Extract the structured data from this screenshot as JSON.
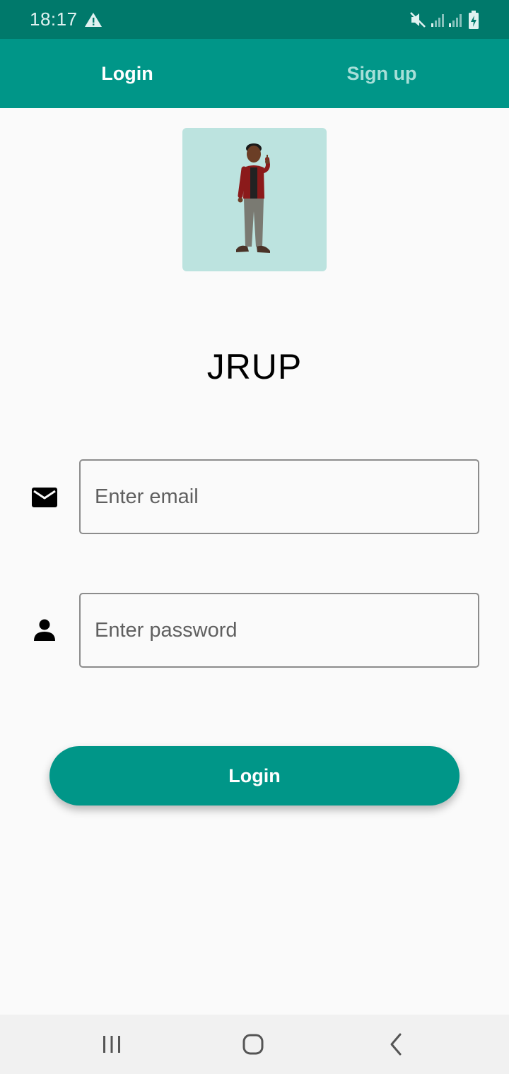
{
  "status_bar": {
    "time": "18:17",
    "icons": [
      "warning-icon",
      "mute-icon",
      "signal-icon",
      "signal-icon",
      "battery-charging-icon"
    ]
  },
  "tabs": [
    {
      "label": "Login",
      "active": true
    },
    {
      "label": "Sign up",
      "active": false
    }
  ],
  "avatar": {
    "description_icon": "avatar-image"
  },
  "app": {
    "title": "JRUP"
  },
  "form": {
    "email_placeholder": "Enter email",
    "email_icon": "mail-icon",
    "password_placeholder": "Enter password",
    "password_icon": "person-icon",
    "login_label": "Login"
  },
  "nav_bar": {
    "buttons": [
      "recents-icon",
      "home-icon",
      "back-icon"
    ]
  },
  "colors": {
    "status_bar": "#00796b",
    "primary": "#009688",
    "tab_inactive_text": "#a7dfd8",
    "avatar_bg": "#bce3df",
    "background": "#fafafa"
  }
}
